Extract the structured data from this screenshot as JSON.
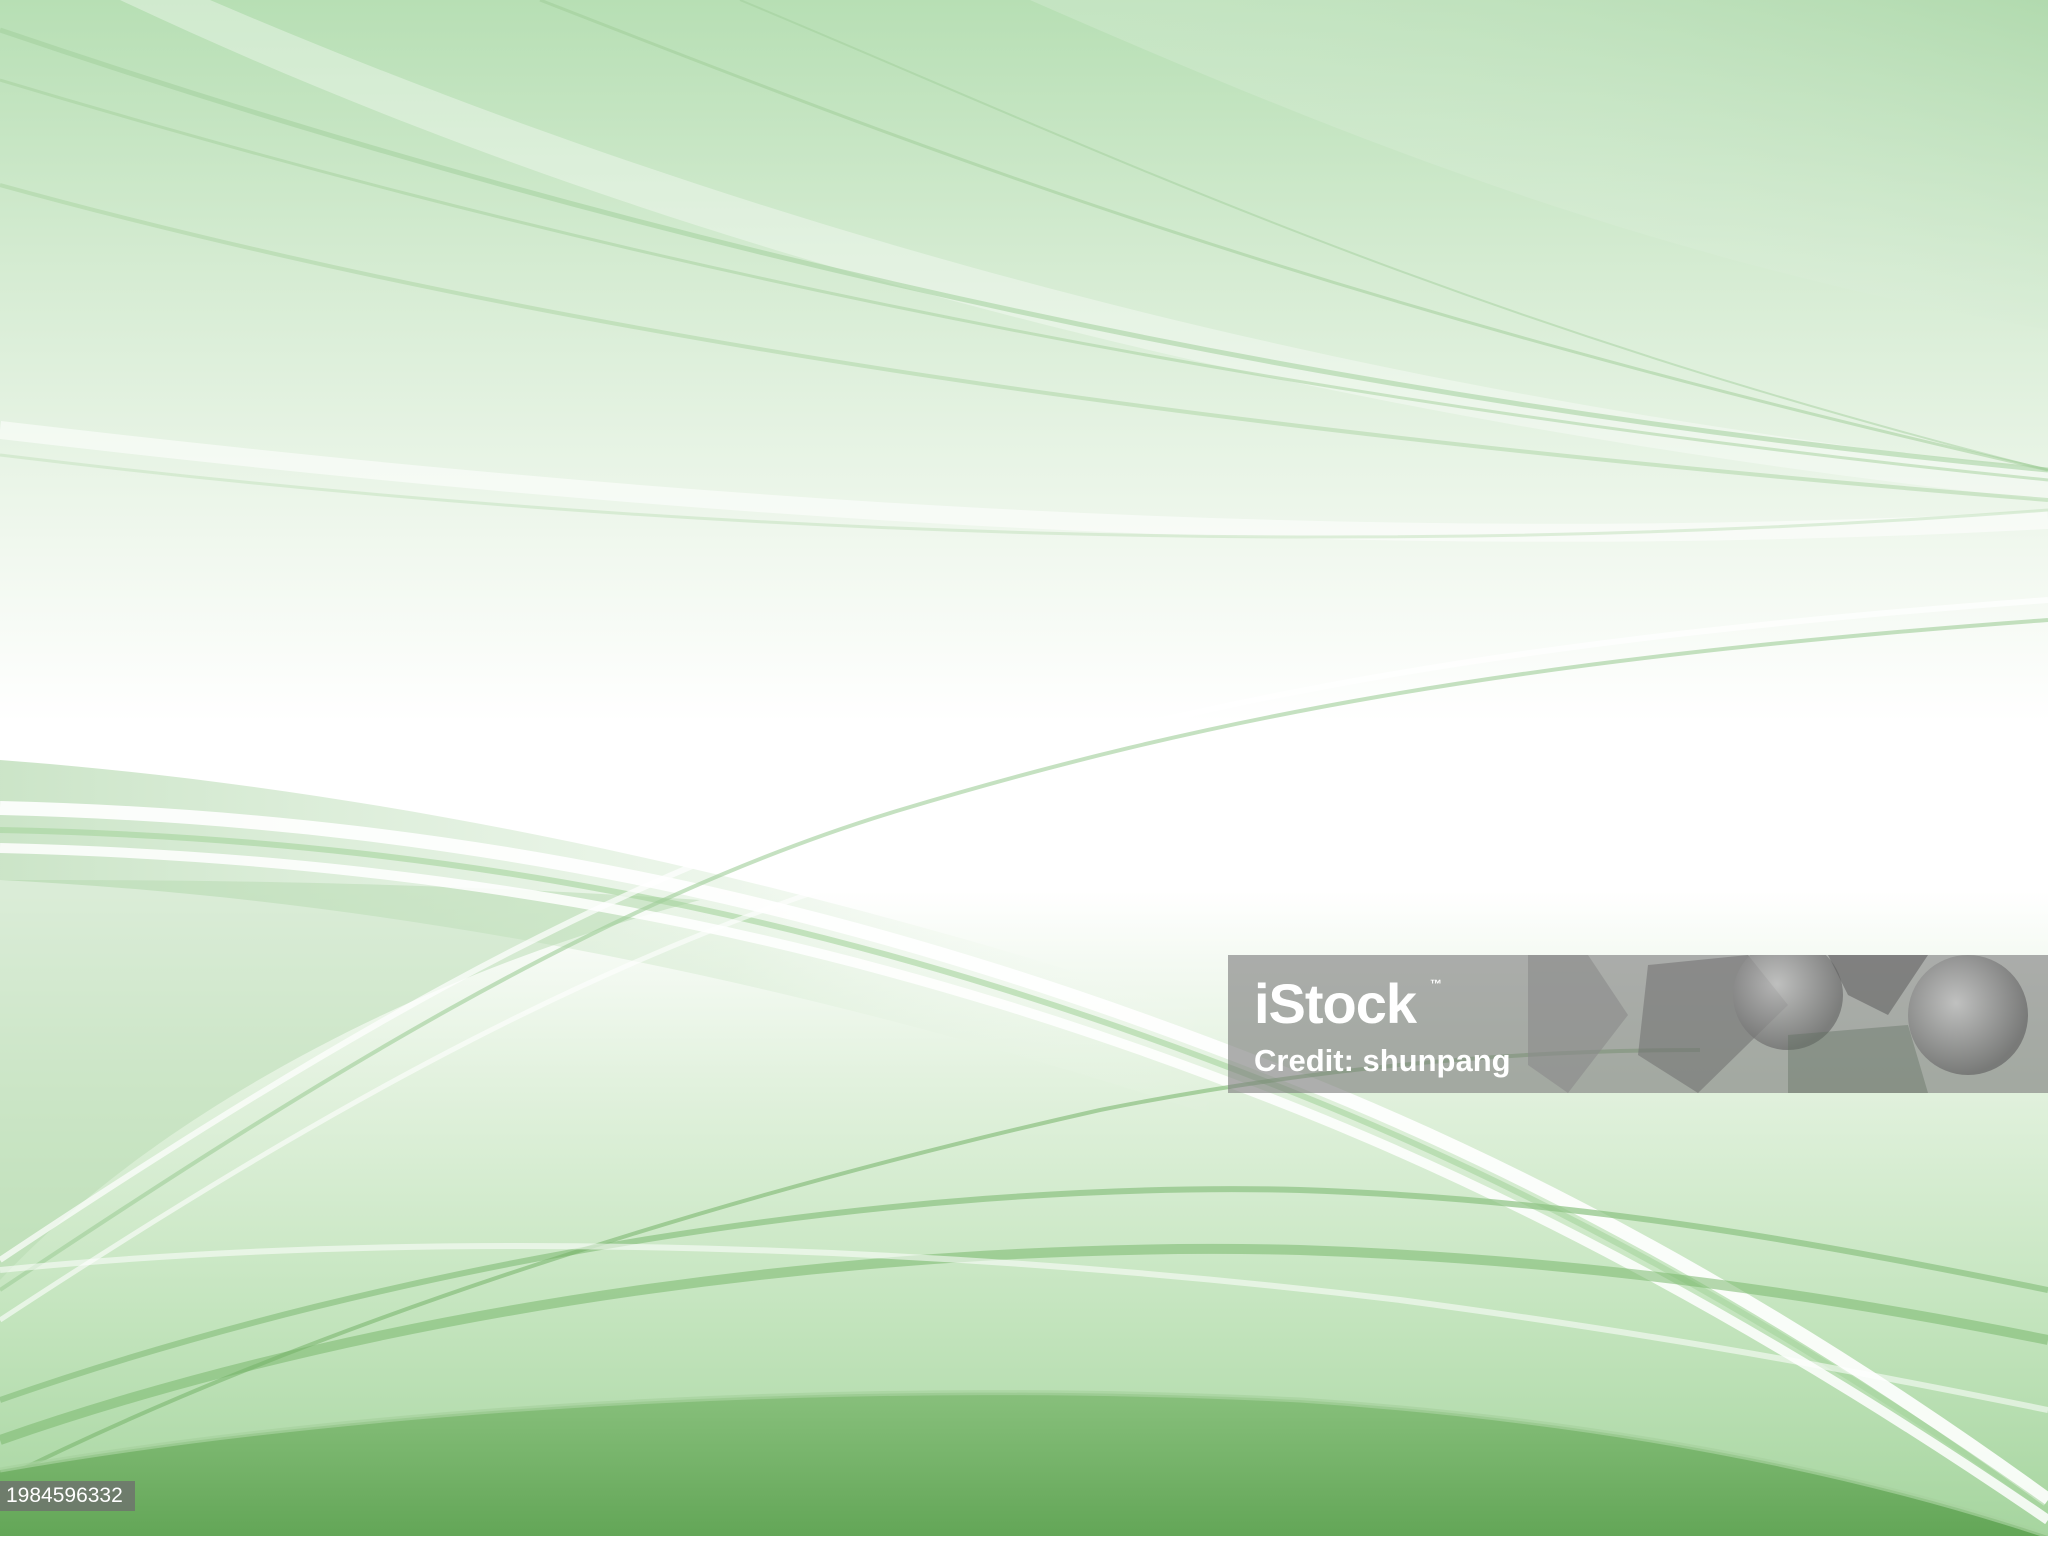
{
  "image": {
    "subject": "abstract-green-curved-lines-background",
    "colors": {
      "top_green": "#b3ddb2",
      "center_white": "#ffffff",
      "bottom_green": "#6fae63",
      "stroke_green": "#5fa854",
      "watermark_bg": "#7d7d7d"
    }
  },
  "watermark": {
    "logo_text": "iStock",
    "trademark": "™",
    "credit_text": "Credit: shunpang"
  },
  "image_id": "1984596332"
}
